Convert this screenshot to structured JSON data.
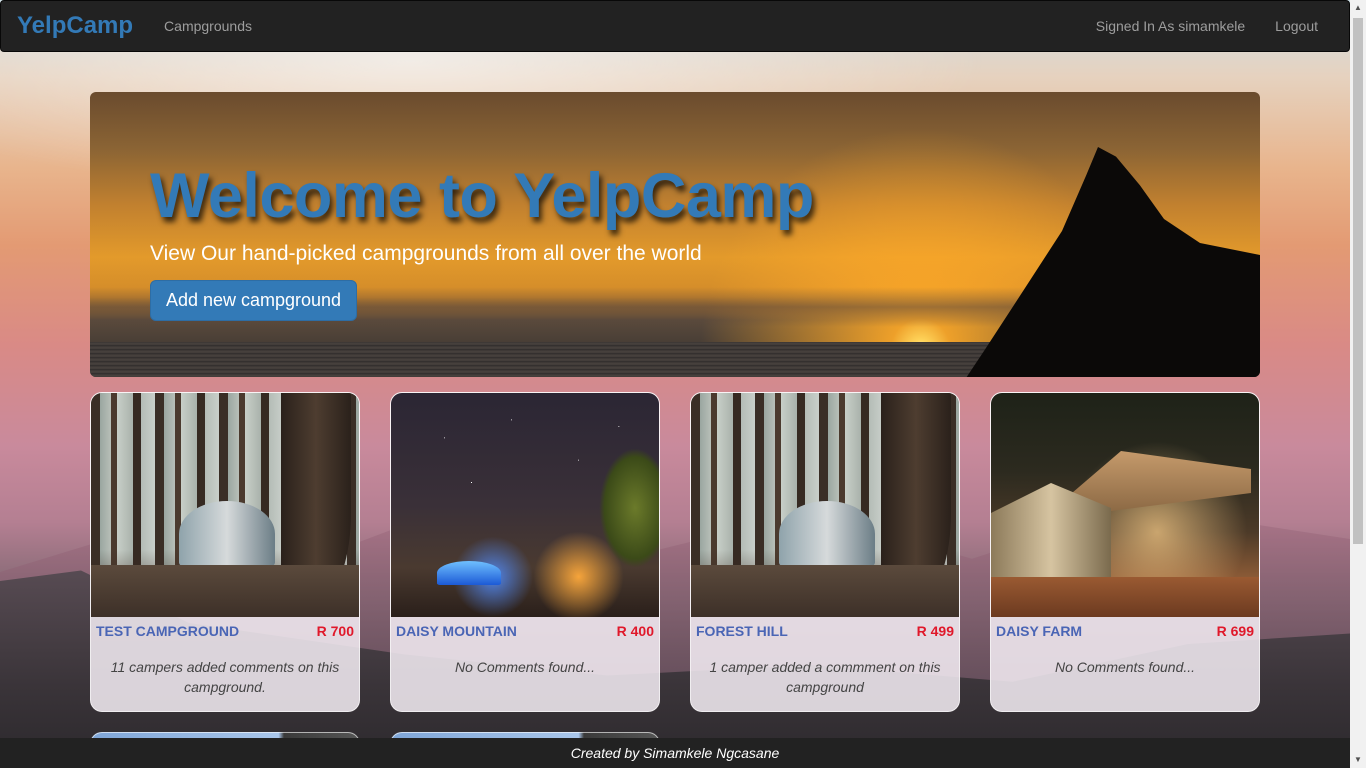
{
  "navbar": {
    "brand": "YelpCamp",
    "campgrounds_link": "Campgrounds",
    "signed_in": "Signed In As simamkele",
    "logout": "Logout"
  },
  "jumbotron": {
    "heading": "Welcome to YelpCamp",
    "subheading": "View Our hand-picked campgrounds from all over the world",
    "button": "Add new campground"
  },
  "campgrounds": [
    {
      "name": "TEST CAMPGROUND",
      "price": "R 700",
      "comments": "11 campers added comments on this campground."
    },
    {
      "name": "DAISY MOUNTAIN",
      "price": "R 400",
      "comments": "No Comments found..."
    },
    {
      "name": "FOREST HILL",
      "price": "R 499",
      "comments": "1 camper added a commment on this campground"
    },
    {
      "name": "DAISY FARM",
      "price": "R 699",
      "comments": "No Comments found..."
    }
  ],
  "footer": {
    "text": "Created by Simamkele Ngcasane"
  },
  "colors": {
    "brand": "#337ab7",
    "navbar_bg": "#222222",
    "title_blue": "#4a65b5",
    "price_red": "#e0182a"
  }
}
